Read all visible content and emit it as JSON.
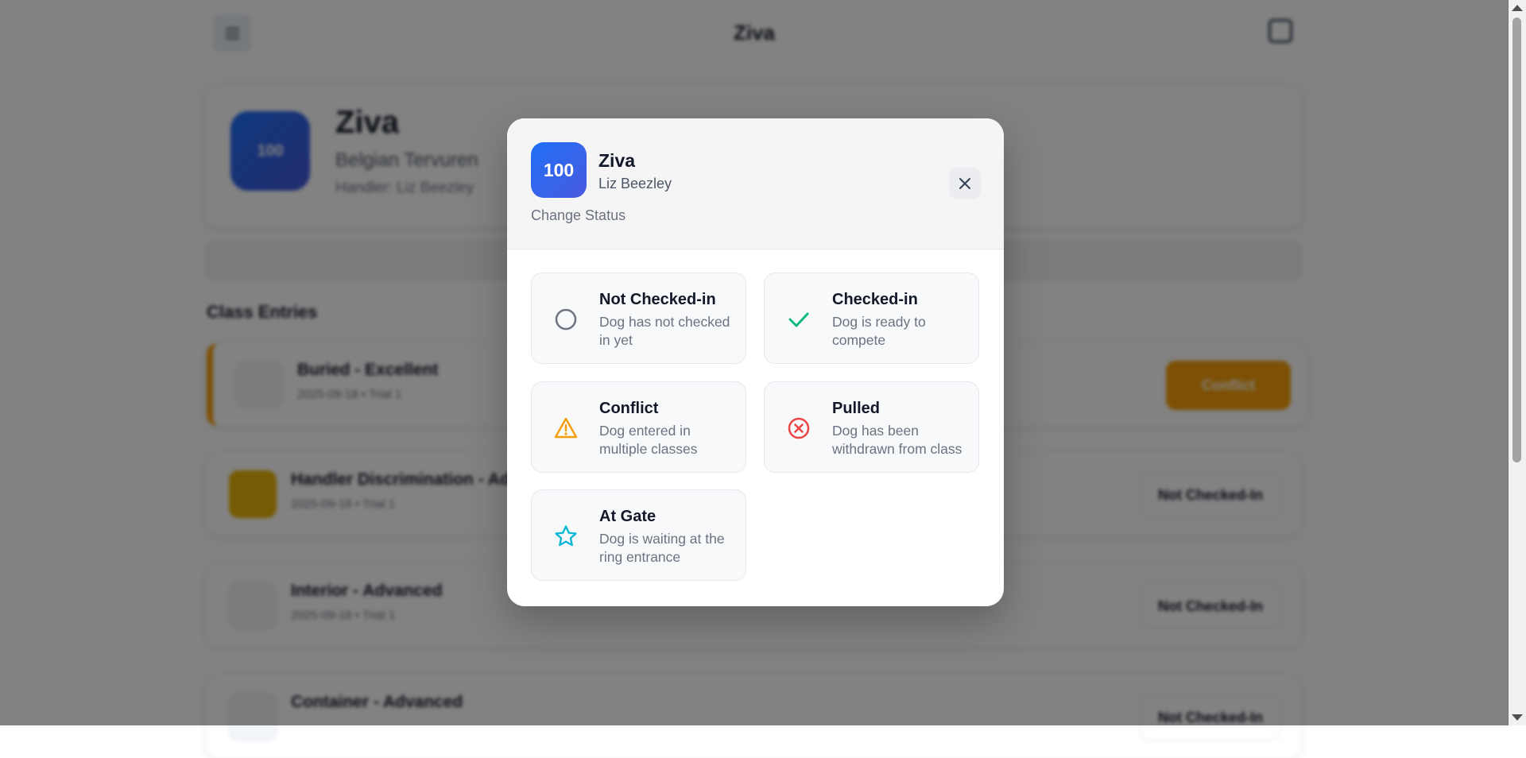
{
  "page": {
    "title": "Ziva",
    "dog": {
      "number": "100",
      "name": "Ziva",
      "breed": "Belgian Tervuren",
      "handler": "Handler: Liz Beezley"
    },
    "section_title": "Class Entries",
    "entries": [
      {
        "title": "Buried - Excellent",
        "sub": "2025-09-18 • Trial 1",
        "status": "Conflict"
      },
      {
        "title": "Handler Discrimination - Advanced",
        "sub": "2025-09-18 • Trial 1",
        "status": "Not Checked-In"
      },
      {
        "title": "Interior - Advanced",
        "sub": "2025-09-18 • Trial 1",
        "status": "Not Checked-In"
      },
      {
        "title": "Container - Advanced",
        "sub": "",
        "status": "Not Checked-In"
      }
    ]
  },
  "modal": {
    "number": "100",
    "name": "Ziva",
    "handler": "Liz Beezley",
    "subtitle": "Change Status",
    "options": [
      {
        "title": "Not Checked-in",
        "desc": "Dog has not checked in yet",
        "icon": "circle-icon",
        "color": "#6b7280"
      },
      {
        "title": "Checked-in",
        "desc": "Dog is ready to compete",
        "icon": "checkmark-icon",
        "color": "#10b981"
      },
      {
        "title": "Conflict",
        "desc": "Dog entered in multiple classes",
        "icon": "warning-icon",
        "color": "#f59e0b"
      },
      {
        "title": "Pulled",
        "desc": "Dog has been withdrawn from class",
        "icon": "x-circle-icon",
        "color": "#ef4444"
      },
      {
        "title": "At Gate",
        "desc": "Dog is waiting at the ring entrance",
        "icon": "star-icon",
        "color": "#06b6d4"
      }
    ]
  },
  "colors": {
    "accent_blue": "#1f6ff5",
    "conflict_orange": "#f59e0b",
    "overlay": "rgba(0,0,0,0.49)"
  }
}
